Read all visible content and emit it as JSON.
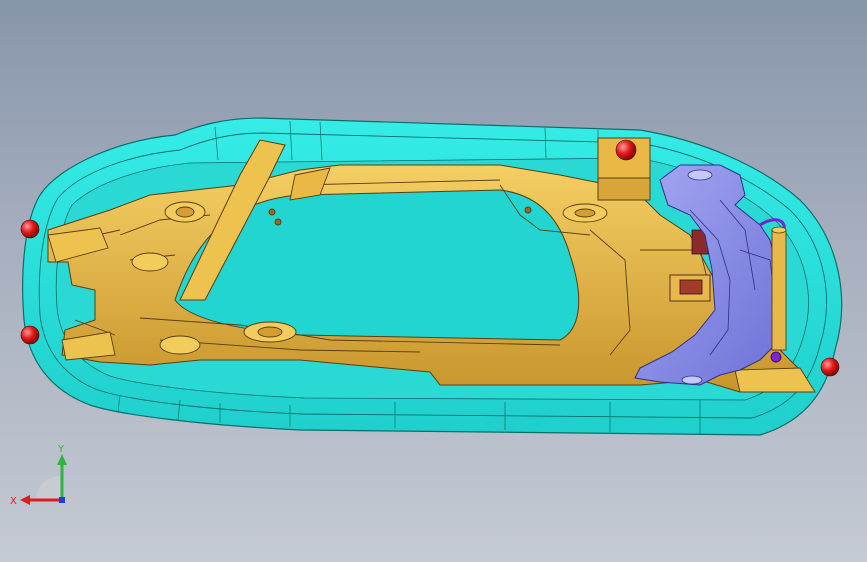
{
  "triad": {
    "x_label": "X",
    "y_label": "Y",
    "x_color": "#d81e1e",
    "y_color": "#2fb53c",
    "z_color": "#1f3fd6"
  },
  "colors": {
    "background_top": "#8795ab",
    "background_bottom": "#c5cad3",
    "mold_plate": "#2fe3de",
    "part_gold": "#e7b84a",
    "part_gold_dark": "#b8892a",
    "slider_purple": "#8b8ee8",
    "marker_red": "#e01818",
    "insert_brown": "#8a2a2a"
  },
  "icons": {
    "markers": [
      "sphere-marker-icon"
    ],
    "triad": "coordinate-triad-icon"
  }
}
